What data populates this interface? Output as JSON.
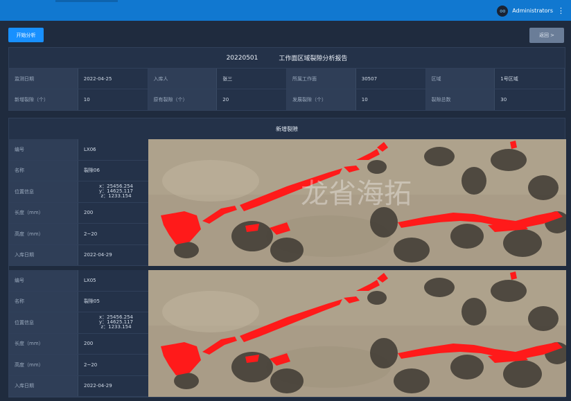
{
  "header": {
    "user_name": "Administrators",
    "avatar_text": "oo"
  },
  "toolbar": {
    "start_label": "开始分析",
    "back_label": "返回 >"
  },
  "report": {
    "date": "20220501",
    "title": "工作面区域裂隙分析报告",
    "rows": [
      [
        {
          "label": "监测日期",
          "value": "2022-04-25"
        },
        {
          "label": "入库人",
          "value": "张三"
        },
        {
          "label": "所属工作面",
          "value": "30507"
        },
        {
          "label": "区域",
          "value": "1号区域"
        }
      ],
      [
        {
          "label": "新增裂隙（个）",
          "value": "10"
        },
        {
          "label": "原有裂隙（个）",
          "value": "20"
        },
        {
          "label": "发展裂隙（个）",
          "value": "10"
        },
        {
          "label": "裂隙总数",
          "value": "30"
        }
      ]
    ]
  },
  "section": {
    "title": "新增裂隙",
    "watermark": "龙省海拓",
    "records": [
      {
        "id_label": "编号",
        "id": "LX06",
        "name_label": "名称",
        "name": "裂隙06",
        "pos_label": "位置信息",
        "x": "x：25456.254",
        "y": "y：14625.117",
        "z": "z：1233.154",
        "length_label": "长度（mm）",
        "length": "200",
        "height_label": "高度（mm）",
        "height": "2~20",
        "date_label": "入库日期",
        "date": "2022-04-29"
      },
      {
        "id_label": "编号",
        "id": "LX05",
        "name_label": "名称",
        "name": "裂隙05",
        "pos_label": "位置信息",
        "x": "x：25456.254",
        "y": "y：14625.117",
        "z": "z：1233.154",
        "length_label": "长度（mm）",
        "length": "200",
        "height_label": "高度（mm）",
        "height": "2~20",
        "date_label": "入库日期",
        "date": "2022-04-29"
      }
    ]
  },
  "colors": {
    "topbar": "#1178d0",
    "primary": "#1890ff",
    "crack": "#ff1a1a",
    "panel": "#243249"
  },
  "icons": {
    "avatar": "avatar-icon",
    "menu": "kebab-menu-icon"
  }
}
